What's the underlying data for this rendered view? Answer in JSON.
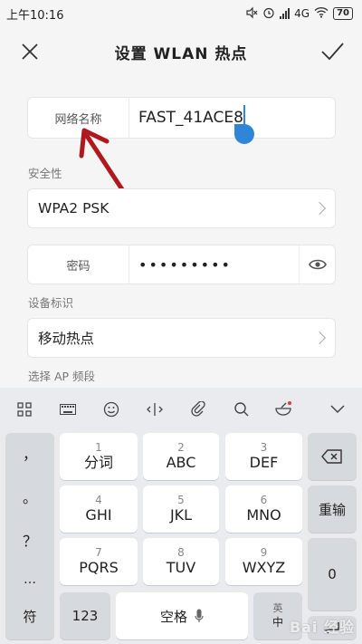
{
  "status_bar": {
    "time": "上午10:16",
    "network": "4G",
    "battery": "70"
  },
  "header": {
    "title": "设置 WLAN 热点"
  },
  "form": {
    "ssid_label": "网络名称",
    "ssid_value": "FAST_41ACE8",
    "security_section": "安全性",
    "security_value": "WPA2 PSK",
    "password_label": "密码",
    "password_value": "•••••••••",
    "device_section": "设备标识",
    "device_value": "移动热点",
    "band_section": "选择 AP 频段"
  },
  "keyboard": {
    "side_keys": [
      "，",
      "。",
      "？",
      "…"
    ],
    "keys": [
      {
        "num": "1",
        "letters": "分词"
      },
      {
        "num": "2",
        "letters": "ABC"
      },
      {
        "num": "3",
        "letters": "DEF"
      },
      {
        "num": "4",
        "letters": "GHI"
      },
      {
        "num": "5",
        "letters": "JKL"
      },
      {
        "num": "6",
        "letters": "MNO"
      },
      {
        "num": "7",
        "letters": "PQRS"
      },
      {
        "num": "8",
        "letters": "TUV"
      },
      {
        "num": "9",
        "letters": "WXYZ"
      }
    ],
    "reenter_label": "重输",
    "zero_label": "0",
    "symbol_label": "符",
    "num_label": "123",
    "space_label": "空格",
    "lang_top": "英",
    "lang_bottom": "中"
  },
  "watermark": "Bai 经验",
  "colors": {
    "accent": "#2f86d8",
    "arrow": "#b01820"
  }
}
